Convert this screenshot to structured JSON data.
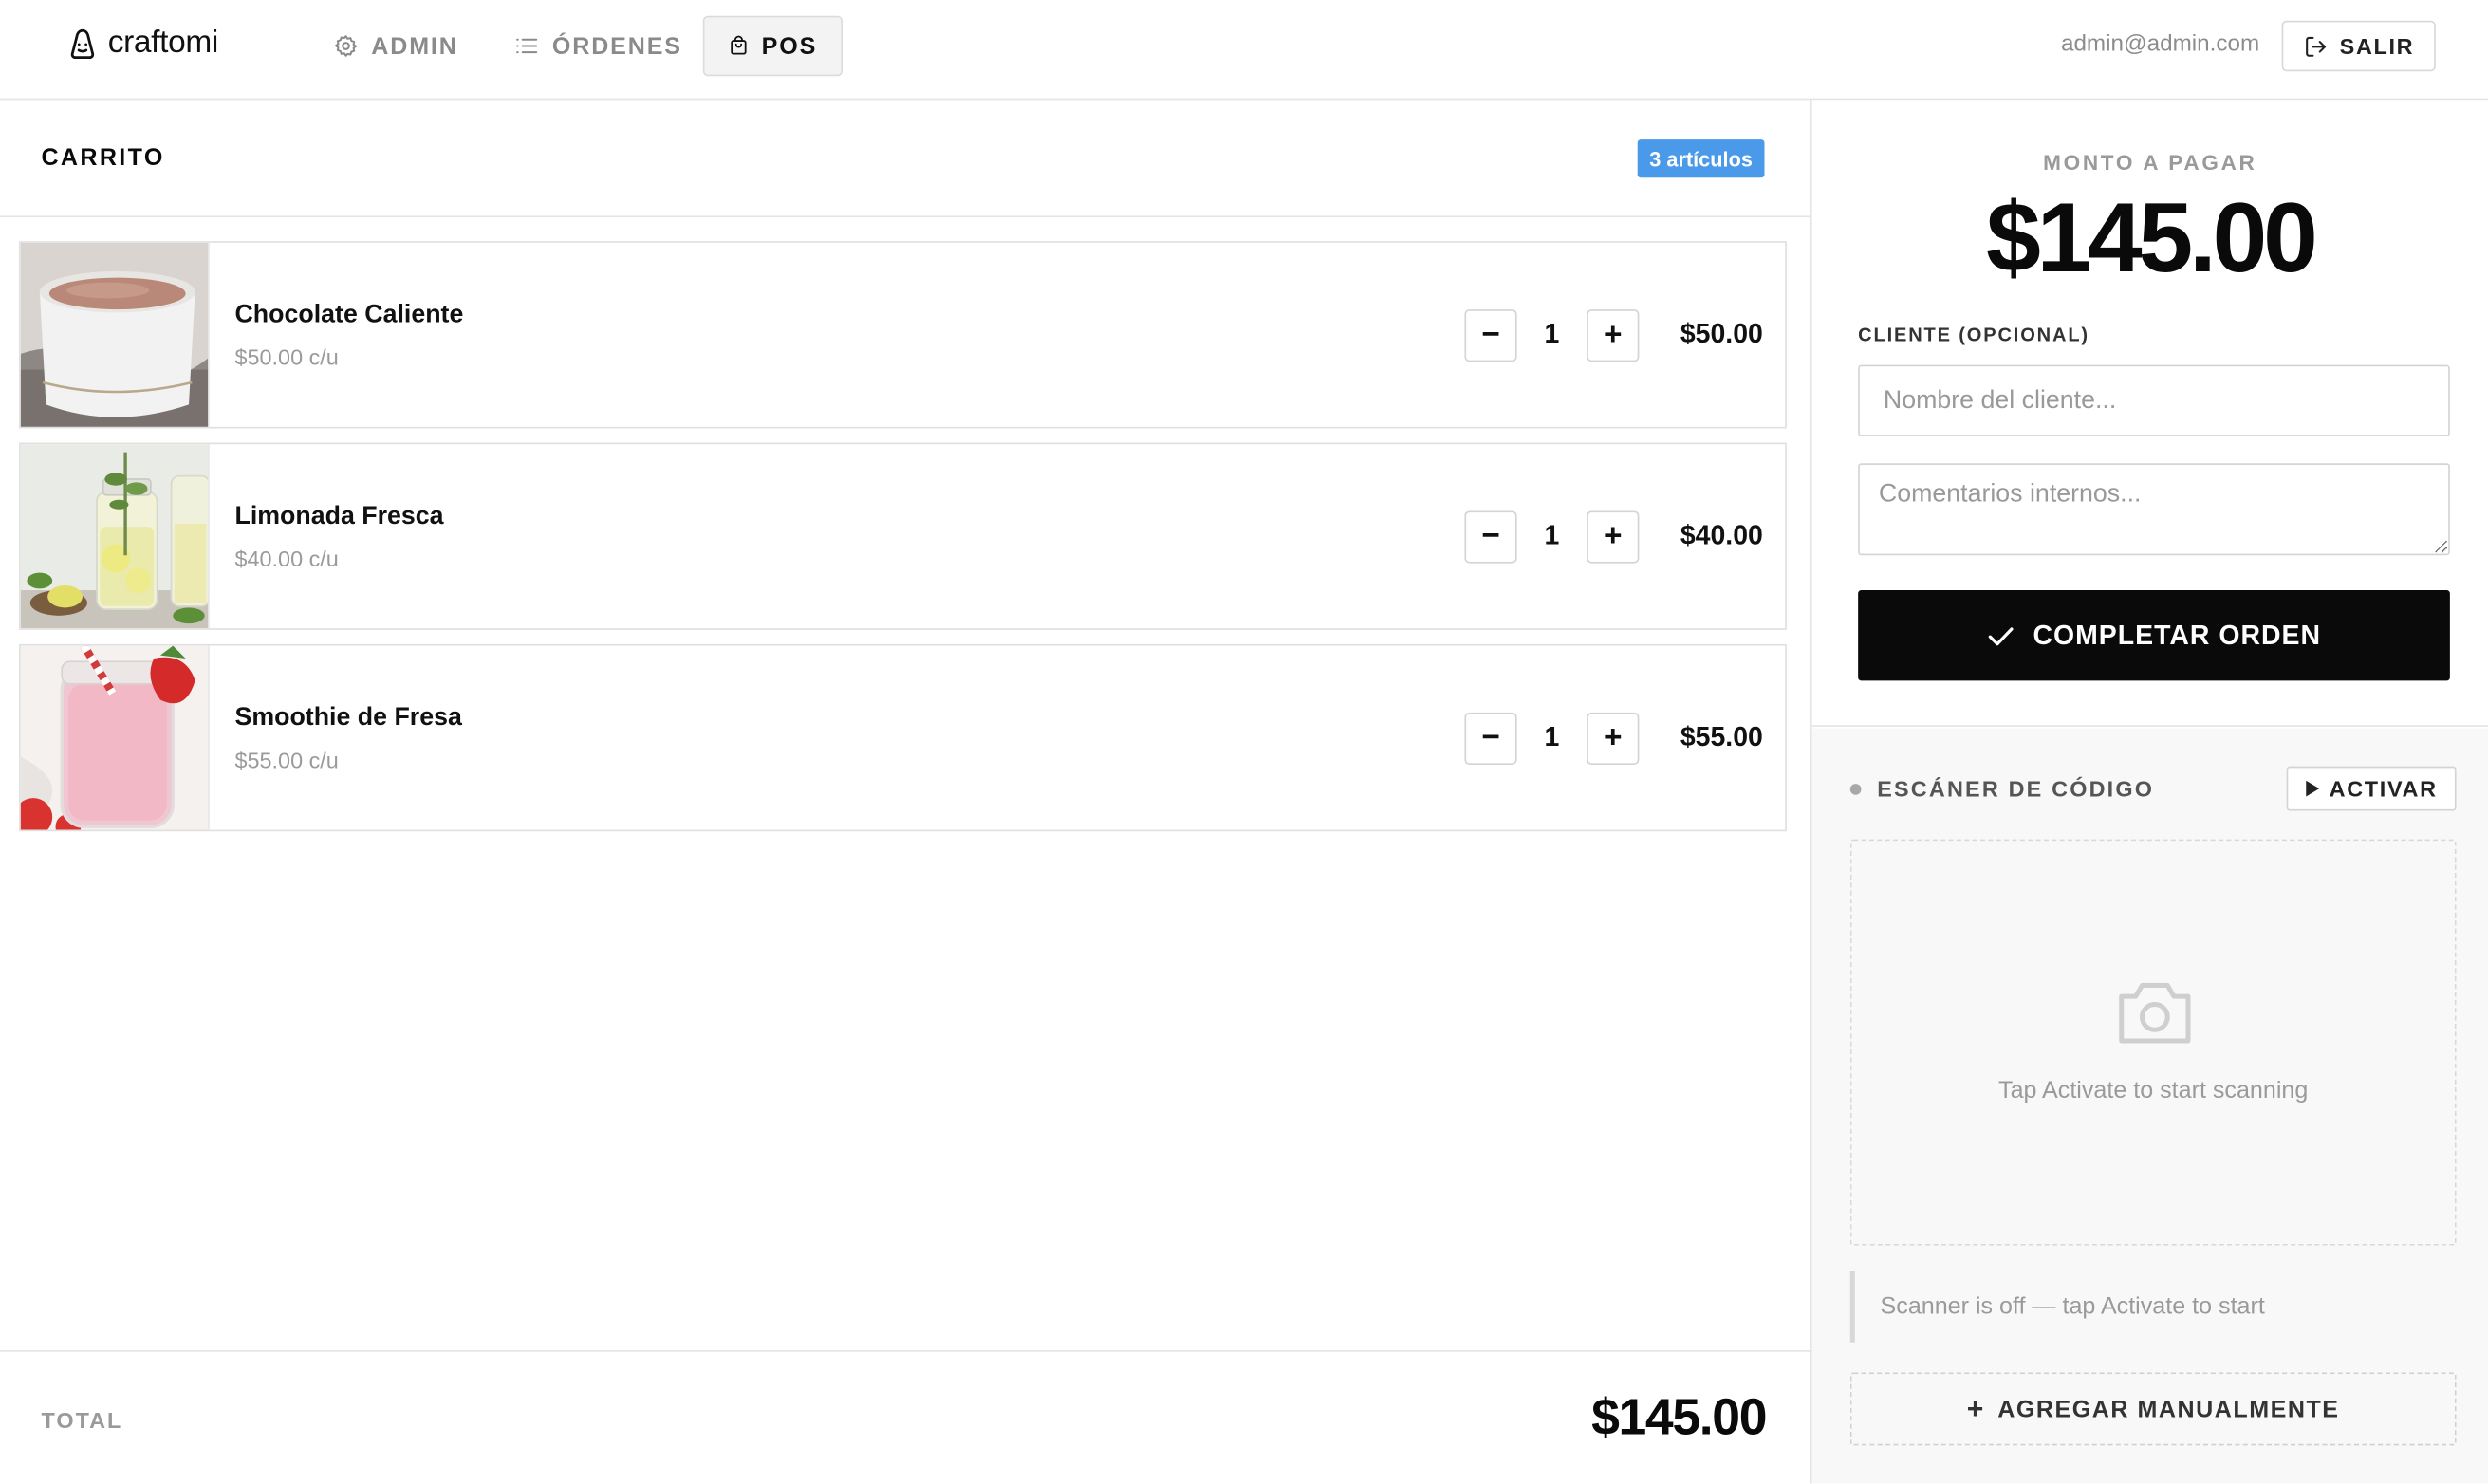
{
  "brand": {
    "name": "craftomi"
  },
  "nav": {
    "admin": "ADMIN",
    "orders": "ÓRDENES",
    "pos": "POS"
  },
  "user": {
    "email": "admin@admin.com",
    "logout_label": "SALIR"
  },
  "cart": {
    "title": "CARRITO",
    "badge": "3 artículos",
    "items": [
      {
        "name": "Chocolate Caliente",
        "unit_price": "$50.00 c/u",
        "qty": "1",
        "price": "$50.00",
        "minus": "−",
        "plus": "+"
      },
      {
        "name": "Limonada Fresca",
        "unit_price": "$40.00 c/u",
        "qty": "1",
        "price": "$40.00",
        "minus": "−",
        "plus": "+"
      },
      {
        "name": "Smoothie de Fresa",
        "unit_price": "$55.00 c/u",
        "qty": "1",
        "price": "$55.00",
        "minus": "−",
        "plus": "+"
      }
    ],
    "total_label": "TOTAL",
    "total_value": "$145.00"
  },
  "payment": {
    "label": "MONTO A PAGAR",
    "amount": "$145.00",
    "client_label": "CLIENTE (OPCIONAL)",
    "client_placeholder": "Nombre del cliente...",
    "client_value": "",
    "notes_placeholder": "Comentarios internos...",
    "notes_value": "",
    "complete_label": "COMPLETAR ORDEN"
  },
  "scanner": {
    "title": "ESCÁNER DE CÓDIGO",
    "activate_label": "ACTIVAR",
    "hint": "Tap Activate to start scanning",
    "status": "Scanner is off — tap Activate to start",
    "manual_label": "AGREGAR MANUALMENTE",
    "manual_icon": "+"
  },
  "colors": {
    "badge": "#4a9ae9",
    "primary": "#0a0a0a",
    "muted": "#9a9a9a"
  },
  "icons": {
    "brand": "smiley-bag-icon",
    "admin": "gear-icon",
    "orders": "list-icon",
    "pos": "shopping-bag-icon",
    "logout": "logout-icon",
    "complete": "check-icon",
    "activate": "play-icon",
    "scan_area": "camera-icon"
  }
}
